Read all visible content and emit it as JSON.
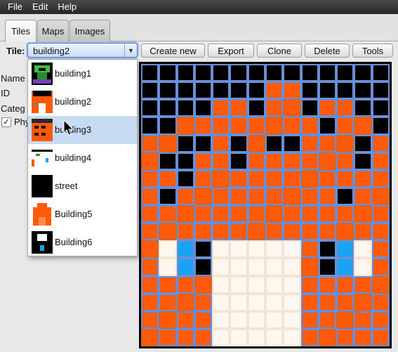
{
  "menubar": {
    "items": [
      "File",
      "Edit",
      "Help"
    ]
  },
  "tabs": [
    {
      "label": "Tiles",
      "active": true
    },
    {
      "label": "Maps",
      "active": false
    },
    {
      "label": "Images",
      "active": false
    }
  ],
  "toolbar": {
    "tile_label": "Tile:",
    "selected_tile": "building2",
    "buttons": [
      "Create new",
      "Export",
      "Clone",
      "Delete",
      "Tools"
    ]
  },
  "properties": {
    "name_label": "Name",
    "id_label": "ID",
    "category_label": "Categ",
    "physics_label": "Phy",
    "physics_checked": true
  },
  "dropdown": {
    "options": [
      "building1",
      "building2",
      "building3",
      "building4",
      "street",
      "Building5",
      "Building6"
    ],
    "highlighted_index": 2
  },
  "colors": {
    "orange": "#ff5a09",
    "black": "#000000",
    "white": "#fdf7ef",
    "blue": "#1aa3f5",
    "grid_line": "#6b8fd6",
    "grid_line_alt": "#c96a33"
  },
  "tile_pixels": [
    "KKKKKKKKKKKKKK",
    "KKKKKKKOOKKKKK",
    "KKKKOOKOOKOOKK",
    "KKOOOOOOOOKOOK",
    "OOKKOKOKKOOOKO",
    "OKKOOKOOOOOOKO",
    "OOKOOOOOOOOOOO",
    "OKOOOOOOOOOKOO",
    "OOOOOOOOOOOOOO",
    "OOOOOOOOOOOOOO",
    "OWBKWWWWWOKBWO",
    "OWBKWWWWWOKBWO",
    "OOOOWWWWWOOOOO",
    "OOOOWWWWWOOOOO",
    "OOOOWWWWWOOOOO",
    "OOOOWWWWWOOOOO"
  ]
}
